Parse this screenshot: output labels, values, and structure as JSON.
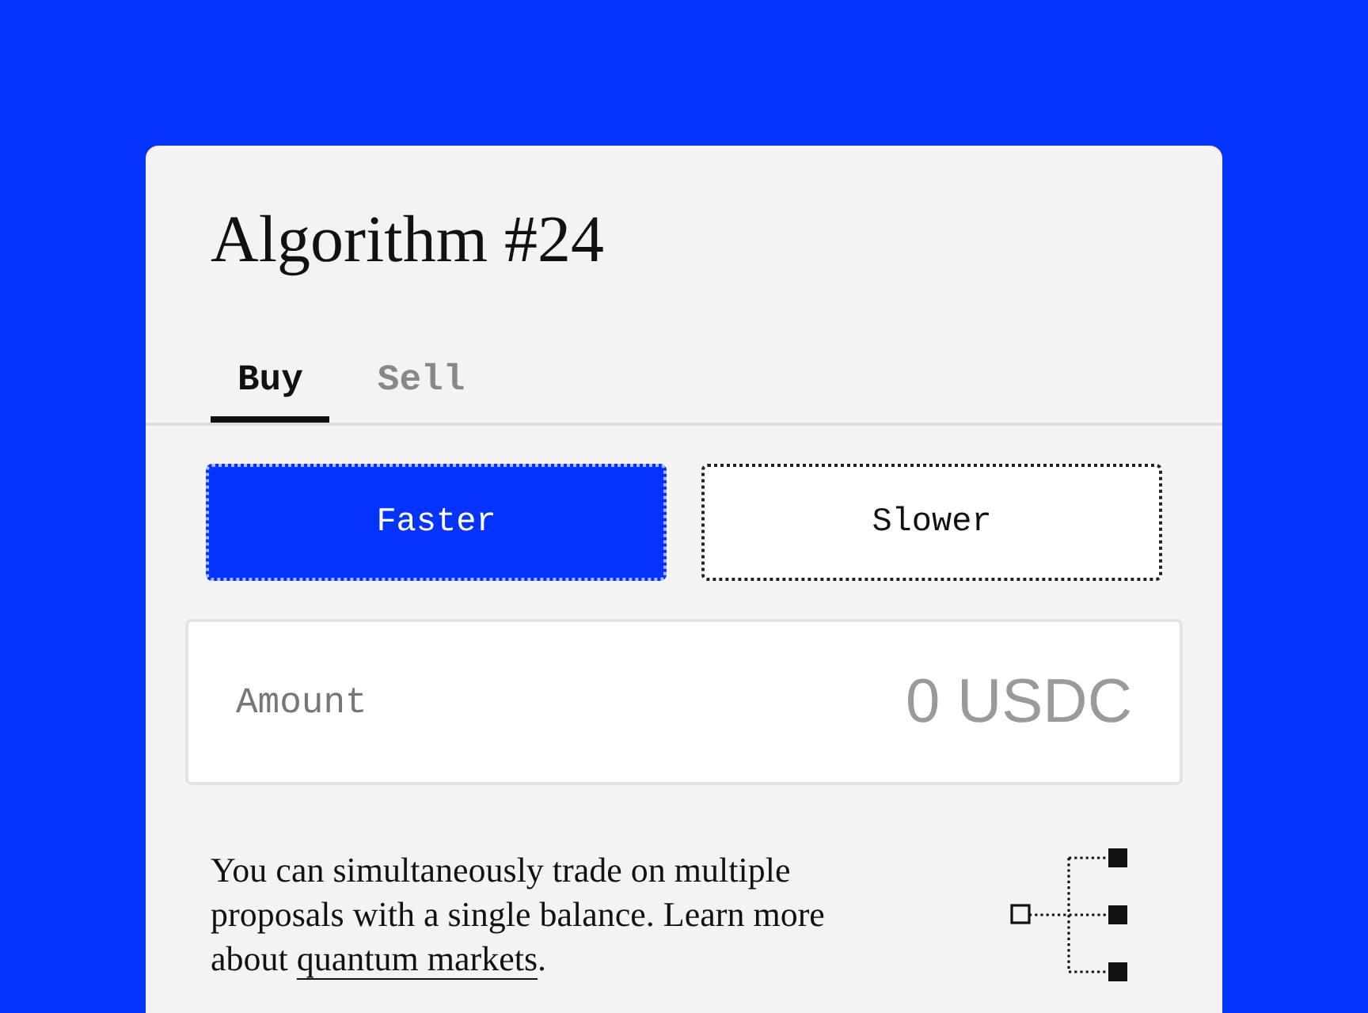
{
  "title": "Algorithm #24",
  "tabs": [
    {
      "label": "Buy",
      "selected": true
    },
    {
      "label": "Sell",
      "selected": false
    }
  ],
  "speed_options": [
    {
      "label": "Faster",
      "selected": true
    },
    {
      "label": "Slower",
      "selected": false
    }
  ],
  "amount": {
    "label": "Amount",
    "placeholder": "0 USDC"
  },
  "note": {
    "text": "You can simultaneously trade on multiple proposals with a single balance. Learn more about ",
    "link": "quantum markets",
    "end": "."
  }
}
